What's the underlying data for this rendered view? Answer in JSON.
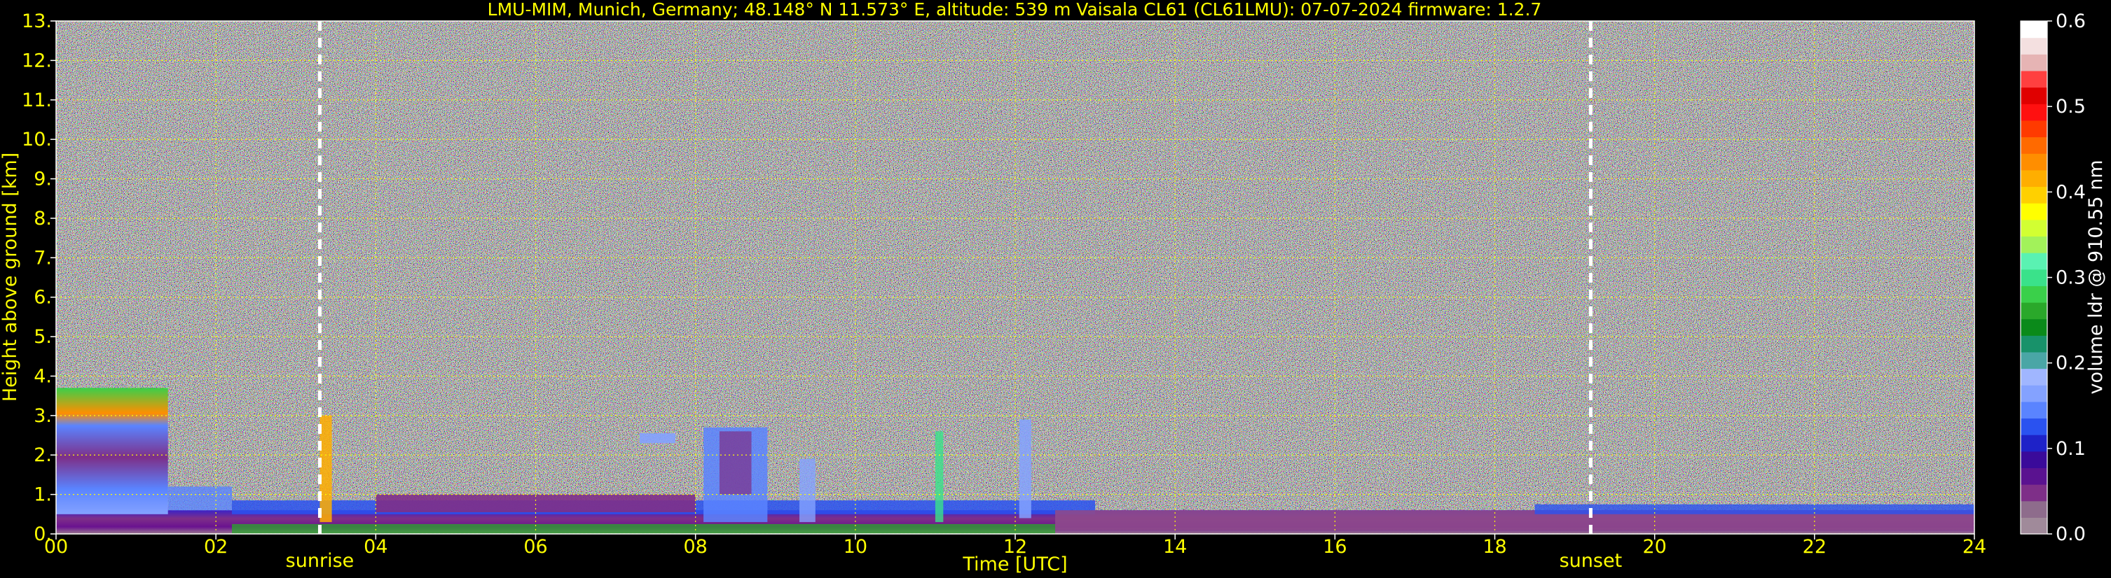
{
  "chart_data": {
    "type": "heatmap",
    "title": "LMU-MIM, Munich, Germany; 48.148° N 11.573° E, altitude: 539 m    Vaisala CL61 (CL61LMU): 07-07-2024    firmware: 1.2.7",
    "xlabel": "Time [UTC]",
    "ylabel": "Height above ground [km]",
    "xlim": [
      0,
      24
    ],
    "ylim": [
      0,
      13
    ],
    "x_ticks": [
      0,
      2,
      4,
      6,
      8,
      10,
      12,
      14,
      16,
      18,
      20,
      22,
      24
    ],
    "x_tick_labels": [
      "00",
      "02",
      "04",
      "06",
      "08",
      "10",
      "12",
      "14",
      "16",
      "18",
      "20",
      "22",
      "24"
    ],
    "y_ticks": [
      0,
      1,
      2,
      3,
      4,
      5,
      6,
      7,
      8,
      9,
      10,
      11,
      12,
      13
    ],
    "y_tick_labels": [
      "0.",
      "1.",
      "2.",
      "3.",
      "4.",
      "5.",
      "6.",
      "7.",
      "8.",
      "9.",
      "10.",
      "11.",
      "12.",
      "13."
    ],
    "grid": true,
    "colorbar": {
      "label": "volume ldr @ 910.55 nm",
      "range": [
        0,
        0.6
      ],
      "ticks": [
        0.0,
        0.1,
        0.2,
        0.3,
        0.4,
        0.5,
        0.6
      ],
      "tick_labels": [
        "0.0",
        "0.1",
        "0.2",
        "0.3",
        "0.4",
        "0.5",
        "0.6"
      ],
      "colors": [
        "#a08a9a",
        "#8e6c8c",
        "#7e2f88",
        "#5a1290",
        "#3a0a9a",
        "#1e22c8",
        "#2a52f0",
        "#5a84ff",
        "#84a2ff",
        "#a0b6ff",
        "#4aa6a6",
        "#18926a",
        "#0a8a1a",
        "#2aa82a",
        "#3ad04a",
        "#3ae28a",
        "#5af2b2",
        "#a2f25a",
        "#d2ff32",
        "#ffff00",
        "#ffd000",
        "#ffae00",
        "#ff8e00",
        "#ff6a00",
        "#ff3a00",
        "#ff1010",
        "#e00000",
        "#ff4040",
        "#e6b4b4",
        "#f4e0e0",
        "#ffffff"
      ]
    },
    "annotations": [
      {
        "label": "sunrise",
        "x": 3.3
      },
      {
        "label": "sunset",
        "x": 19.2
      }
    ]
  }
}
